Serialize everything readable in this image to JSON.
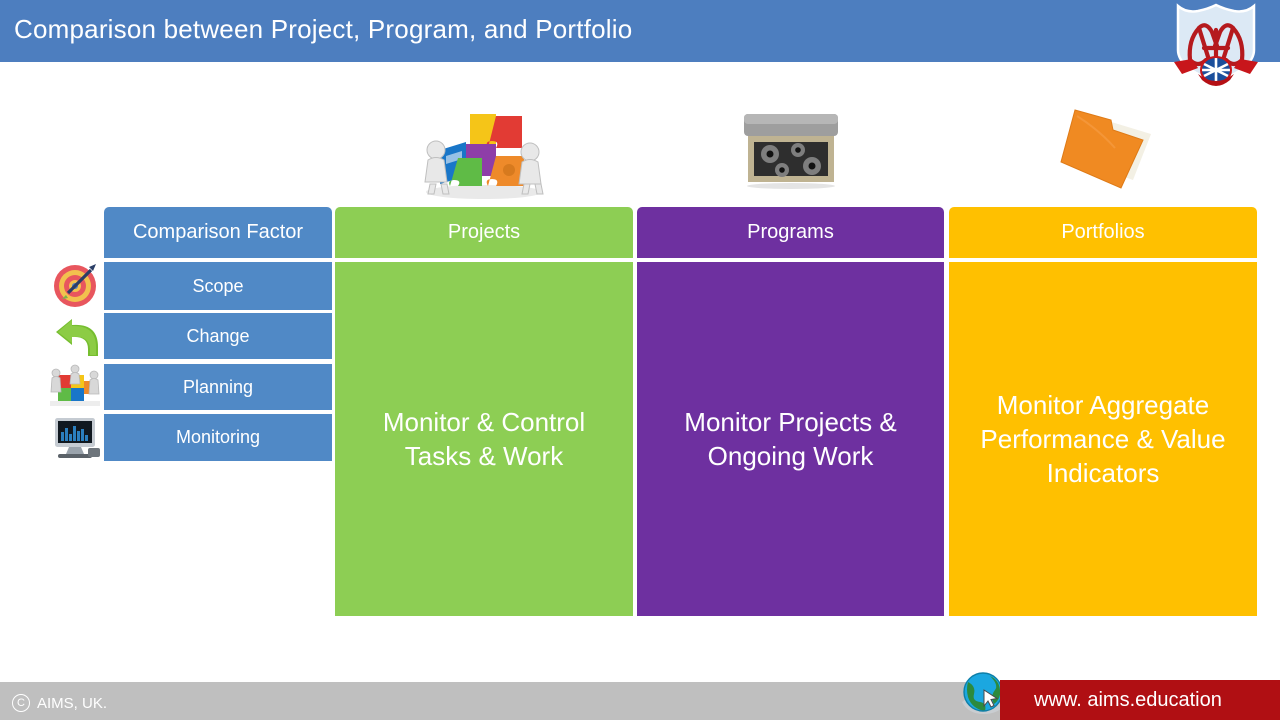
{
  "header": {
    "title": "Comparison between Project, Program, and Portfolio",
    "bg_color": "#4D7EBF",
    "logo_name": "aims-crest-logo"
  },
  "top_icons": [
    {
      "name": "puzzle-people-icon",
      "for_column": "Projects"
    },
    {
      "name": "gear-box-icon",
      "for_column": "Programs"
    },
    {
      "name": "orange-folder-icon",
      "for_column": "Portfolios"
    }
  ],
  "table": {
    "headers": [
      {
        "label": "Comparison Factor",
        "color": "#5089C6"
      },
      {
        "label": "Projects",
        "color": "#8DCE54"
      },
      {
        "label": "Programs",
        "color": "#6E30A0"
      },
      {
        "label": "Portfolios",
        "color": "#FFC000"
      }
    ],
    "factors": [
      {
        "label": "Scope",
        "icon": "target-dartboard-icon"
      },
      {
        "label": "Change",
        "icon": "green-curved-arrow-icon"
      },
      {
        "label": "Planning",
        "icon": "puzzle-collaboration-icon"
      },
      {
        "label": "Monitoring",
        "icon": "computer-monitor-icon"
      }
    ],
    "panels": [
      {
        "column": "Projects",
        "text": "Monitor & Control Tasks & Work",
        "color": "#8DCE54"
      },
      {
        "column": "Programs",
        "text": "Monitor Projects & Ongoing Work",
        "color": "#6E30A0"
      },
      {
        "column": "Portfolios",
        "text": "Monitor Aggregate Performance & Value Indicators",
        "color": "#FFC000"
      }
    ]
  },
  "footer": {
    "copyright_symbol": "C",
    "copyright_text": "AIMS, UK.",
    "url": "www. aims.education",
    "bar_color": "#BFBFBF",
    "url_bar_color": "#B00F13",
    "globe_icon": "globe-cursor-icon"
  }
}
